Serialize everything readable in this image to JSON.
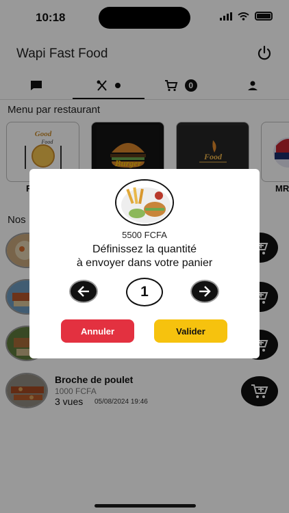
{
  "status_bar": {
    "time": "10:18"
  },
  "header": {
    "title": "Wapi Fast Food"
  },
  "tabs": {
    "cart_count": "0"
  },
  "sections": {
    "menu_by_restaurant": "Menu par restaurant",
    "second_section": "Nos"
  },
  "restaurants": [
    {
      "label": "F"
    },
    {
      "label": ""
    },
    {
      "label": ""
    },
    {
      "label": "MR"
    }
  ],
  "restaurant_logos": {
    "good_food": "Good Food",
    "burger": "Burger",
    "food": "Food"
  },
  "products": [
    {
      "name": "Broche de poulet",
      "price": "1000 FCFA",
      "views": "3 vues",
      "date": "05/08/2024 19:46"
    }
  ],
  "modal": {
    "price": "5500 FCFA",
    "line1": "Définissez la quantité",
    "line2": "à envoyer dans votre panier",
    "quantity": "1",
    "cancel_label": "Annuler",
    "confirm_label": "Valider"
  },
  "colors": {
    "cancel": "#e33140",
    "confirm": "#f6c20e",
    "overlay": "rgba(0,0,0,0.40)"
  }
}
